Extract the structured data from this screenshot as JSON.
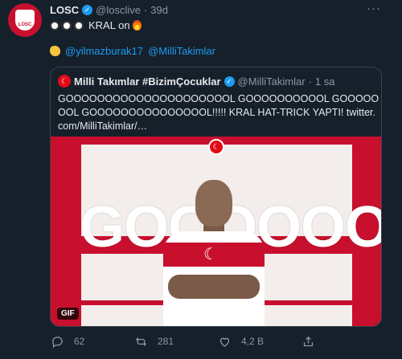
{
  "tweet": {
    "name": "LOSC",
    "handle": "@losclive",
    "separator": "·",
    "time": "39d",
    "more": "···",
    "avatar_text": "LOSC",
    "text_main": "KRAL on",
    "mentions": [
      "@yilmazburak17",
      "@MilliTakimlar"
    ],
    "icons": [
      "soccer-ball-icon",
      "soccer-ball-icon",
      "soccer-ball-icon",
      "fire-icon",
      "clapping-hands-icon"
    ]
  },
  "quote": {
    "name": "Milli Takımlar #BizimÇocuklar",
    "handle": "@MilliTakimlar",
    "separator": "·",
    "time": "1 sa",
    "text": "GOOOOOOOOOOOOOOOOOOOOOL GOOOOOOOOOOL GOOOOOOOL GOOOOOOOOOOOOOOOL!!!!! KRAL HAT-TRICK YAPTI! twitter.com/MilliTakimlar/…",
    "media": {
      "headline": "GOOOOOOOL",
      "badge": "GIF"
    }
  },
  "actions": {
    "reply": "62",
    "retweet": "281",
    "like": "4,2 B",
    "share": ""
  },
  "colors": {
    "background": "#15202b",
    "accent": "#1d9bf0",
    "muted": "#8b98a5",
    "border": "#38444d",
    "red": "#c8102e"
  }
}
